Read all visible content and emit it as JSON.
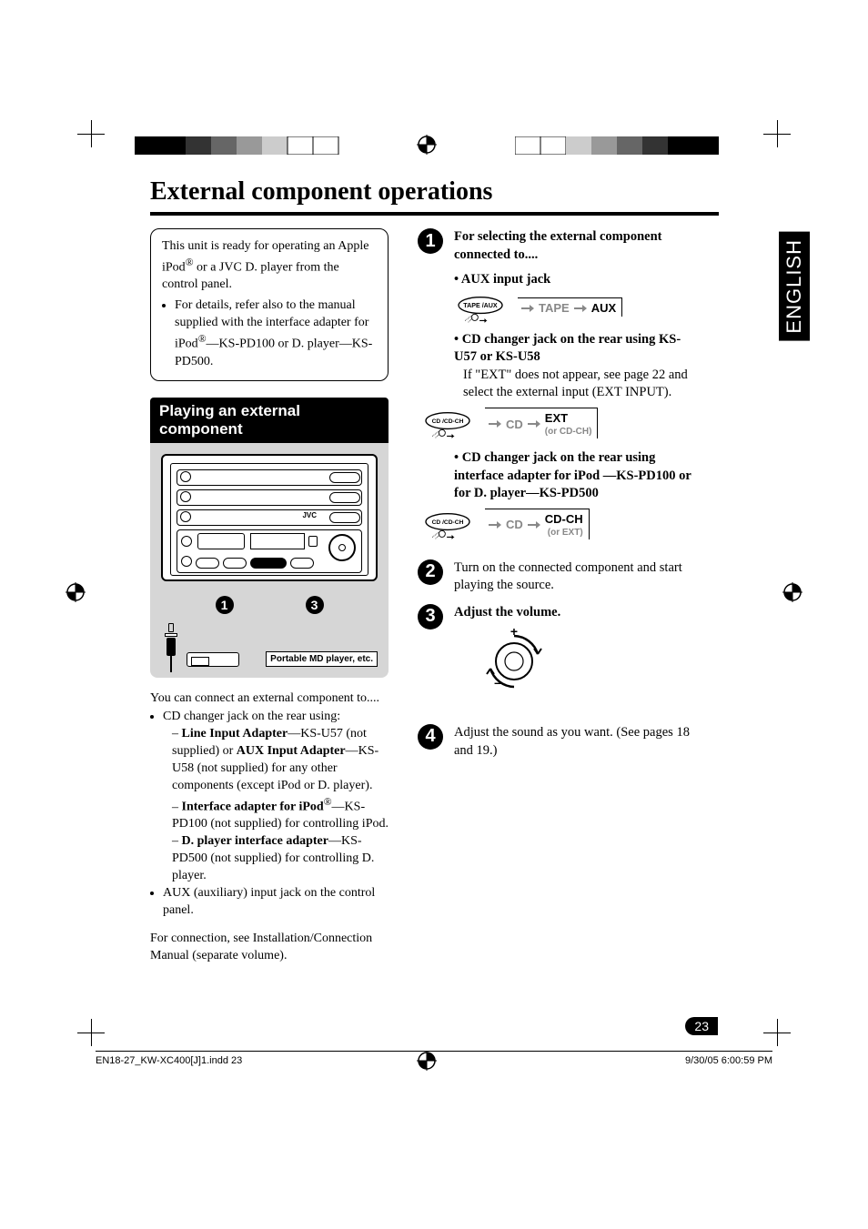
{
  "title": "External component operations",
  "language_tab": "ENGLISH",
  "intro": {
    "text_a": "This unit is ready for operating an Apple iPod",
    "text_b": " or a JVC D. player from the control panel.",
    "bullet": "For details, refer also to the manual supplied with the interface adapter for iPod",
    "bullet_b": "—KS-PD100 or D. player—KS-PD500."
  },
  "section_bar": "Playing an external component",
  "md_label": "Portable MD player, etc.",
  "unit_brand": "JVC",
  "connect_intro": "You can connect an external component to....",
  "connect_bullets": {
    "b1": "CD changer jack on the rear using:",
    "b1a_a": "Line Input Adapter",
    "b1a_b": "—KS-U57 (not supplied) or ",
    "b1a_c": "AUX Input Adapter",
    "b1a_d": "—KS-U58 (not supplied) for any other components (except iPod or D. player).",
    "b1b_a": "Interface adapter for iPod",
    "b1b_b": "—KS-PD100 (not supplied) for controlling iPod.",
    "b1c_a": "D. player interface adapter",
    "b1c_b": "—KS-PD500 (not supplied) for controlling D. player.",
    "b2": "AUX (auxiliary) input jack on the control panel."
  },
  "connect_footnote": "For connection, see Installation/Connection Manual (separate volume).",
  "steps": {
    "s1": {
      "heading": "For selecting the external component connected to....",
      "aux": "AUX input jack",
      "aux_btn": "TAPE /AUX",
      "aux_flow_a": "TAPE",
      "aux_flow_b": "AUX",
      "cd1": "CD changer jack on the rear using KS-U57 or KS-U58",
      "cd1_note": "If \"EXT\" does not appear, see page 22 and select the external input (EXT INPUT).",
      "cd_btn": "CD /CD-CH",
      "cd1_flow_a": "CD",
      "cd1_flow_b": "EXT",
      "cd1_flow_sub": "(or CD-CH)",
      "cd2": "CD changer jack on the rear using interface adapter for iPod —KS-PD100 or for D. player—KS-PD500",
      "cd2_flow_a": "CD",
      "cd2_flow_b": "CD-CH",
      "cd2_flow_sub": "(or EXT)"
    },
    "s2": "Turn on the connected component and start playing the source.",
    "s3": "Adjust the volume.",
    "s4": "Adjust the sound as you want. (See pages 18 and 19.)"
  },
  "page_number": "23",
  "footer": {
    "file": "EN18-27_KW-XC400[J]1.indd   23",
    "timestamp": "9/30/05   6:00:59 PM"
  }
}
